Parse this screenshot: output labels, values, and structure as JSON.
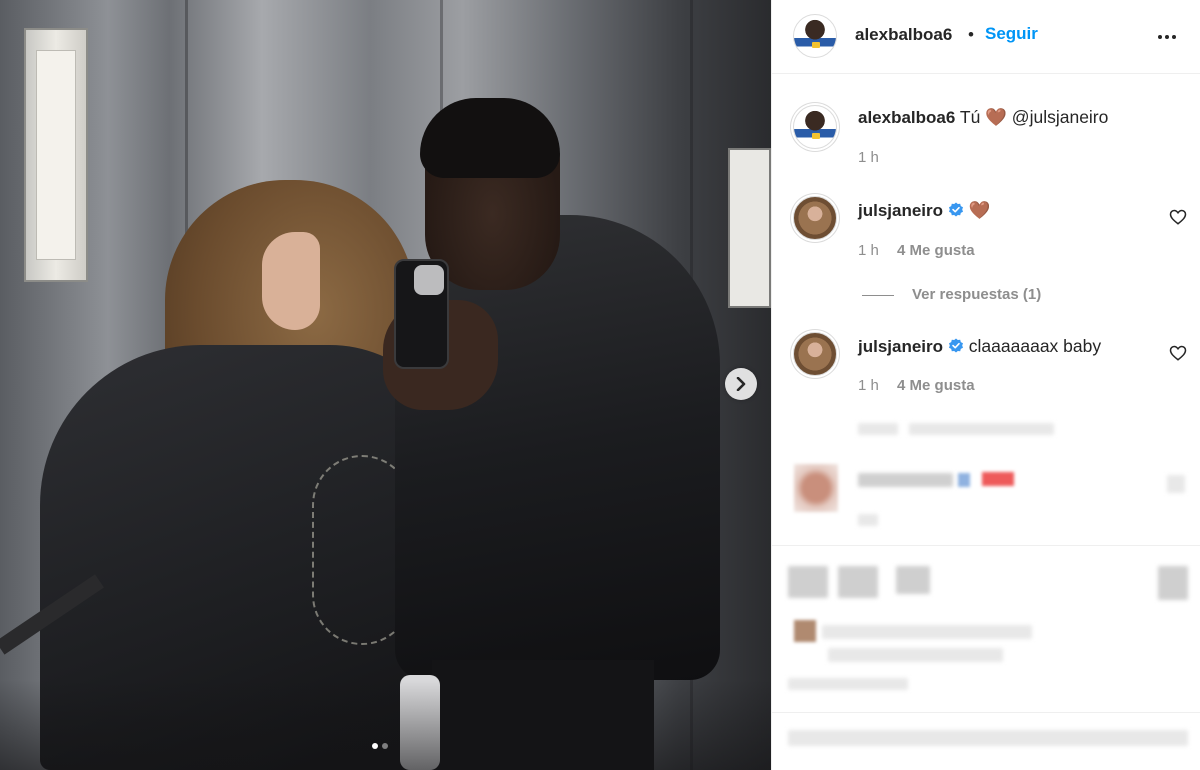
{
  "header": {
    "username": "alexbalboa6",
    "separator": "•",
    "follow_label": "Seguir"
  },
  "caption": {
    "username": "alexbalboa6",
    "text": "Tú 🤎 @julsjaneiro",
    "time": "1 h"
  },
  "comments": [
    {
      "username": "julsjaneiro",
      "text": "🤎",
      "time": "1 h",
      "likes": "4 Me gusta"
    },
    {
      "username": "julsjaneiro",
      "text": "claaaaaaax baby",
      "time": "1 h",
      "likes": "4 Me gusta"
    }
  ],
  "replies": {
    "label": "Ver respuestas (1)"
  },
  "carousel": {
    "total": 2,
    "active": 1
  },
  "colors": {
    "link": "#0095f6",
    "verified": "#3897f0",
    "text": "#262626",
    "muted": "#8e8e8e"
  },
  "icons": {
    "more": "more-options-icon",
    "next": "chevron-right-icon",
    "like": "heart-outline-icon",
    "verified": "verified-badge-icon"
  }
}
